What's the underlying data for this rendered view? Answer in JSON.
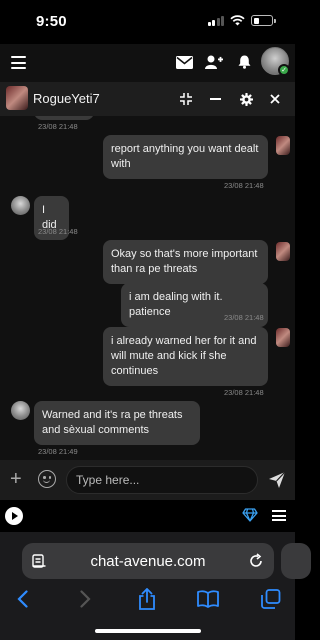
{
  "status_bar": {
    "time": "9:50"
  },
  "app_header": {
    "icons": [
      "hamburger-icon",
      "mail-icon",
      "add-user-icon",
      "bell-icon",
      "avatar"
    ],
    "online_indicator": "check"
  },
  "chat_header": {
    "username": "RogueYeti7",
    "icons": [
      "minimize-icon",
      "dash-icon",
      "gear-icon",
      "close-icon"
    ]
  },
  "messages": [
    {
      "from": "other",
      "text": "",
      "time": "23/08 21:48"
    },
    {
      "from": "me",
      "text": "report anything you want dealt with",
      "time": "23/08 21:48"
    },
    {
      "from": "other",
      "text": "I did",
      "time": "23/08 21:48"
    },
    {
      "from": "me",
      "text": "Okay so that's more important than ra pe threats",
      "time": ""
    },
    {
      "from": "me",
      "text": "i am dealing with it. patience",
      "time": "23/08 21:48"
    },
    {
      "from": "me",
      "text": "i already warned her for it and will mute and kick if she continues",
      "time": "23/08 21:48"
    },
    {
      "from": "other",
      "text": "Warned and it's ra pe threats and sèxual comments",
      "time": "23/08 21:49"
    }
  ],
  "composer": {
    "placeholder": "Type here..."
  },
  "browser": {
    "url": "chat-avenue.com"
  },
  "colors": {
    "bubble": "#3a3a3a",
    "background": "#111111",
    "online_green": "#3aa84a",
    "browser_accent": "#2f8cff",
    "gem_blue": "#3aa0f0"
  }
}
